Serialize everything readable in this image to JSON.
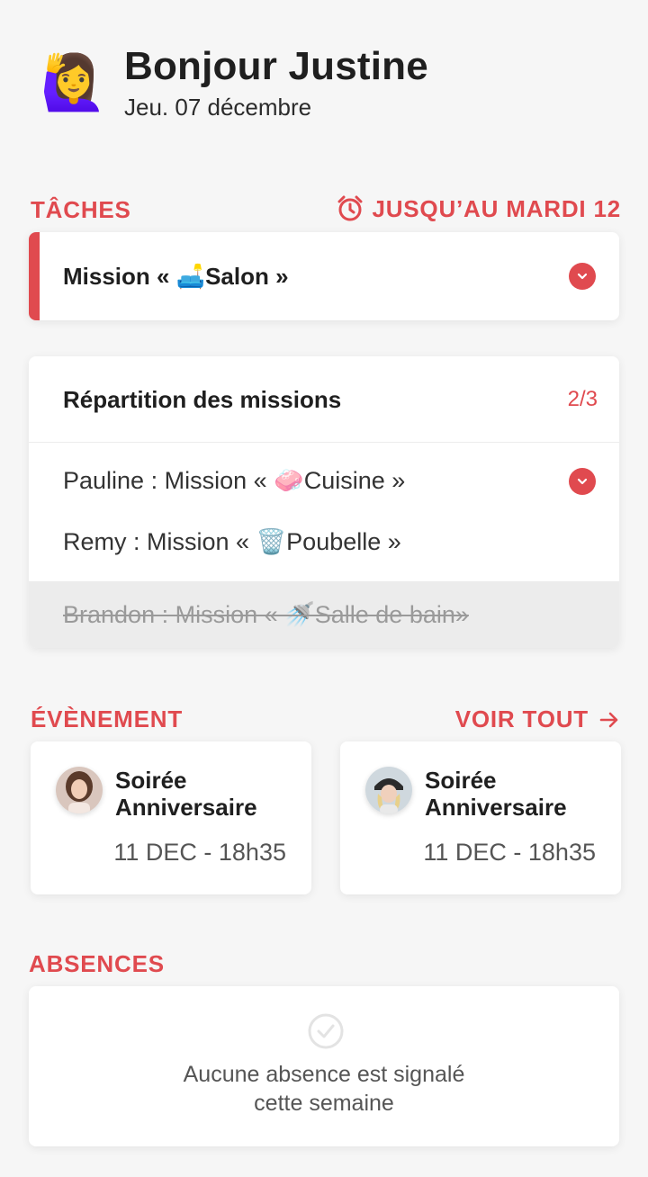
{
  "header": {
    "emoji": "🙋‍♀️",
    "greeting": "Bonjour Justine",
    "date": "Jeu. 07 décembre"
  },
  "tasks": {
    "title": "TÂCHES",
    "deadline": "JUSQU’AU MARDI 12",
    "mission": {
      "label": "Mission « 🛋️Salon »"
    }
  },
  "repartition": {
    "title": "Répartition des missions",
    "count": "2/3",
    "rows": [
      {
        "text": "Pauline :  Mission « 🧼Cuisine »",
        "done": false
      },
      {
        "text": "Remy : Mission « 🗑️Poubelle »",
        "done": false
      },
      {
        "text": "Brandon : Mission « 🚿Salle de bain»",
        "done": true
      }
    ]
  },
  "events": {
    "title": "ÉVÈNEMENT",
    "see_all": "VOIR TOUT",
    "items": [
      {
        "title": "Soirée Anniversaire",
        "time": "11 DEC - 18h35"
      },
      {
        "title": "Soirée Anniversaire",
        "time": "11 DEC - 18h35"
      }
    ]
  },
  "absences": {
    "title": "ABSENCES",
    "message_line1": "Aucune absence est signalé",
    "message_line2": "cette semaine"
  },
  "colors": {
    "accent": "#e04a4f",
    "background": "#f6f6f6"
  }
}
